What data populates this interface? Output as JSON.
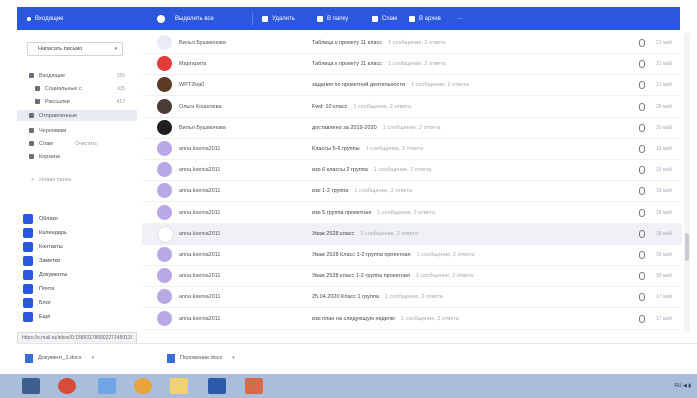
{
  "topbar": {
    "folder_label": "Входящие",
    "select_label": "Выделить все",
    "actions": [
      "Удалить",
      "В папку",
      "Спам",
      "В архив"
    ],
    "more": "···"
  },
  "sidebar": {
    "compose_label": "Написать письмо",
    "folders": [
      {
        "label": "Входящие",
        "count": "155"
      },
      {
        "label": "Социальные с",
        "count": "105"
      },
      {
        "label": "Рассылки",
        "count": "417"
      },
      {
        "label": "Отправленные",
        "count": ""
      },
      {
        "label": "Черновики",
        "count": ""
      },
      {
        "label": "Спам",
        "count": "Очистить"
      },
      {
        "label": "Корзина",
        "count": ""
      }
    ],
    "new_folder": "Новая папка",
    "apps": [
      "Облако",
      "Календарь",
      "Контакты",
      "Заметки",
      "Документы",
      "Почта",
      "Блог",
      "Ещё"
    ]
  },
  "mails": [
    {
      "sender": "Вилья Бушмонова",
      "subject": "Таблица к проекту 11 класс",
      "snippet": "1 сообщение, 2 ответа",
      "avatar_color": "#e9ecf7",
      "date": "21 май"
    },
    {
      "sender": "Маргарита",
      "subject": "Таблица к проекту 11 класс",
      "snippet": "1 сообщение, 2 ответа",
      "avatar_color": "#e23b3b",
      "date": "21 май"
    },
    {
      "sender": "WPT2kia0",
      "subject": "задания по проектной деятельности",
      "snippet": "1 сообщение, 2 ответа",
      "avatar_color": "#5c3a24",
      "date": "21 май"
    },
    {
      "sender": "Ольга Кошелева",
      "subject": "Fwd: 10 класс",
      "snippet": "1 сообщение, 2 ответа",
      "avatar_color": "#4a3c35",
      "date": "20 май"
    },
    {
      "sender": "Вилья Бушмонова",
      "subject": "доставлено за 2019-2020",
      "snippet": "1 сообщение, 2 ответа",
      "avatar_color": "#1f1f1f",
      "date": "20 май"
    },
    {
      "sender": "anna.ksenia2011",
      "subject": "Классы 5-6 группы",
      "snippet": "1 сообщение, 2 ответа",
      "avatar_color": "#b9a8e6",
      "date": "19 май"
    },
    {
      "sender": "anna.ksenia2011",
      "subject": "изо 6 классы 2 группа",
      "snippet": "1 сообщение, 2 ответа",
      "avatar_color": "#b9a8e6",
      "date": "19 май"
    },
    {
      "sender": "anna.ksenia2011",
      "subject": "изо 1-2 группа",
      "snippet": "1 сообщение, 2 ответа",
      "avatar_color": "#b9a8e6",
      "date": "19 май"
    },
    {
      "sender": "anna.ksenia2011",
      "subject": "изо 5 группа проектная",
      "snippet": "1 сообщение, 2 ответа",
      "avatar_color": "#b9a8e6",
      "date": "18 май"
    },
    {
      "sender": "anna.ksenia2011",
      "subject": "Уваж 2528 класс",
      "snippet": "1 сообщение, 2 ответа",
      "avatar_color": "#ffffff",
      "date": "18 май"
    },
    {
      "sender": "anna.ksenia2011",
      "subject": "Уваж 2528 Класс 1-2 группа проектная",
      "snippet": "1 сообщение, 2 ответа",
      "avatar_color": "#b9a8e6",
      "date": "18 май"
    },
    {
      "sender": "anna.ksenia2011",
      "subject": "Уваж 2528 класс 1-2 группа проектная",
      "snippet": "1 сообщение, 2 ответа",
      "avatar_color": "#b9a8e6",
      "date": "18 май"
    },
    {
      "sender": "anna.ksenia2011",
      "subject": "25.04.2020 Класс 1 группа",
      "snippet": "1 сообщение, 2 ответа",
      "avatar_color": "#b9a8e6",
      "date": "17 май"
    },
    {
      "sender": "anna.ksenia2011",
      "subject": "изо план на следующую неделю",
      "snippet": "1 сообщение, 2 ответа",
      "avatar_color": "#b9a8e6",
      "date": "17 май"
    }
  ],
  "status_url": "https://e.mail.ru/inbox/0:15893178650227145013/",
  "downloads": [
    "Документ_1.docx",
    "Положение.docx"
  ],
  "taskbar": {
    "tray": "RU ◀ ▮"
  },
  "colors": {
    "accent": "#2a57dc",
    "taskbar": "#a8bedb",
    "avatar_purple": "#b9a8e6"
  }
}
